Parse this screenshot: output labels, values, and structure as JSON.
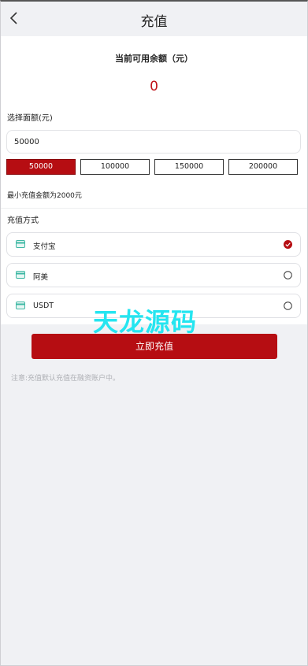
{
  "header": {
    "title": "充值",
    "back_icon": "chevron-left-icon"
  },
  "balance": {
    "label": "当前可用余额（元）",
    "value": "0",
    "value_color": "#c0161c"
  },
  "amount": {
    "label": "选择面额(元)",
    "value": "50000"
  },
  "presets": [
    {
      "label": "50000",
      "selected": true
    },
    {
      "label": "100000",
      "selected": false
    },
    {
      "label": "150000",
      "selected": false
    },
    {
      "label": "200000",
      "selected": false
    }
  ],
  "min_note": "最小充值金额为2000元",
  "methods": {
    "label": "充值方式",
    "items": [
      {
        "name": "支付宝",
        "selected": true,
        "icon": "card-icon"
      },
      {
        "name": "阿美",
        "selected": false,
        "icon": "card-icon"
      },
      {
        "name": "USDT",
        "selected": false,
        "icon": "card-icon"
      }
    ]
  },
  "submit_label": "立即充值",
  "note": "注意:充值默认充值在融资账户中。",
  "watermark": "天龙源码",
  "colors": {
    "accent": "#b60d12",
    "background": "#f0f1f4",
    "watermark": "#25e5f0"
  }
}
